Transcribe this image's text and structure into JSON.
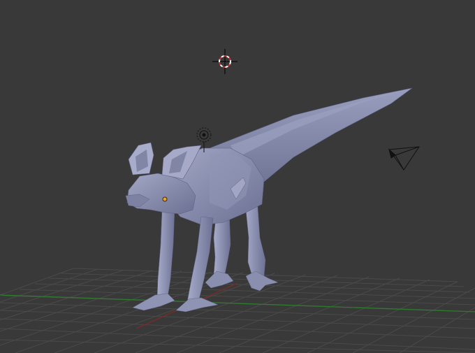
{
  "viewport": {
    "background": "#393939",
    "grid_color": "#4a4a4a",
    "x_axis_color": "#7a2a2a",
    "y_axis_color": "#2e7a2e",
    "mesh_color": "#8e93b4",
    "mesh_shadow_color": "#6a6f90",
    "selected_origin_color": "#f0a030"
  },
  "objects": [
    {
      "name": "creature-mesh",
      "type": "mesh"
    },
    {
      "name": "3d-cursor",
      "type": "cursor"
    },
    {
      "name": "lamp",
      "type": "light"
    },
    {
      "name": "camera",
      "type": "camera"
    }
  ]
}
